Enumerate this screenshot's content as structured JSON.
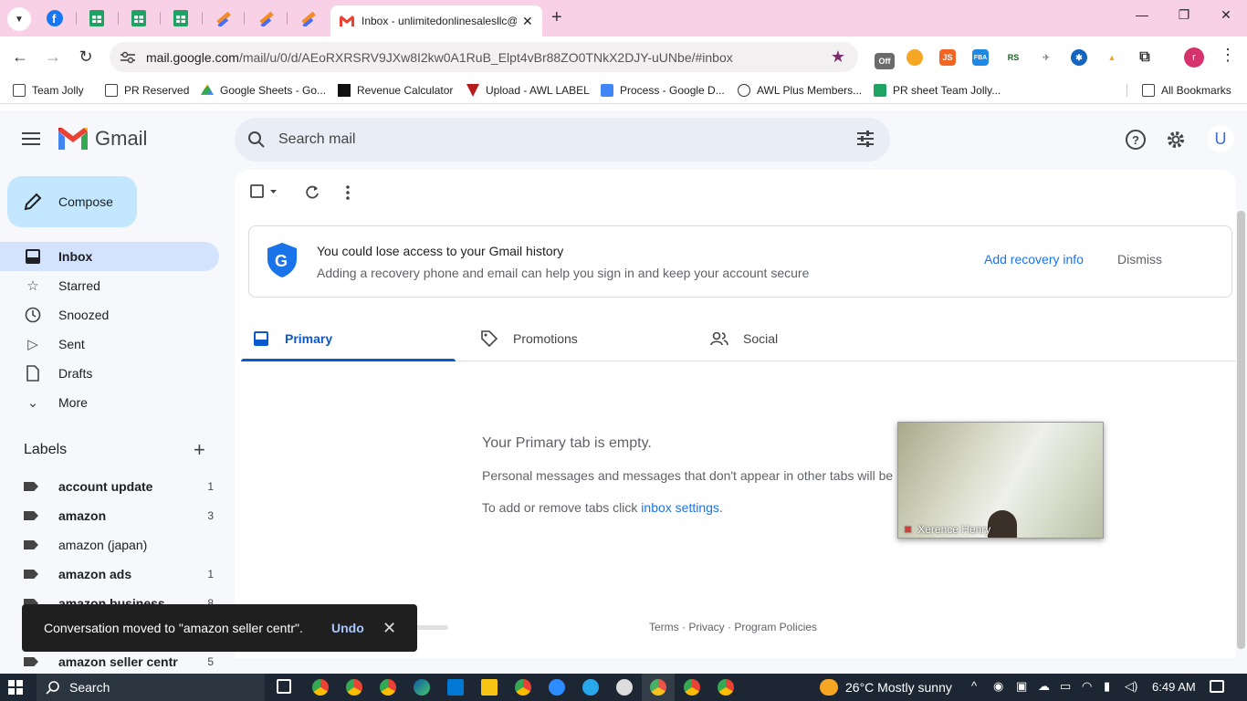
{
  "browser": {
    "active_tab_title": "Inbox - unlimitedonlinesalesllc@",
    "url_host": "mail.google.com",
    "url_path": "/mail/u/0/d/AEoRXRSRV9JXw8I2kw0A1RuB_Elpt4vBr88ZO0TNkX2DJY-uUNbe/#inbox",
    "profile_initial": "r",
    "bookmarks": [
      "Team Jolly",
      "PR Reserved",
      "Google Sheets - Go...",
      "Revenue Calculator",
      "Upload - AWL LABEL",
      "Process - Google D...",
      "AWL Plus Members...",
      "PR sheet Team Jolly..."
    ],
    "all_bookmarks": "All Bookmarks",
    "extension_labels": [
      "Off",
      "JS",
      "FBA",
      "RS"
    ]
  },
  "gmail": {
    "brand": "Gmail",
    "search_placeholder": "Search mail",
    "account_initial": "U",
    "compose": "Compose",
    "nav": [
      {
        "label": "Inbox",
        "icon": "inbox-icon"
      },
      {
        "label": "Starred",
        "icon": "star-icon"
      },
      {
        "label": "Snoozed",
        "icon": "clock-icon"
      },
      {
        "label": "Sent",
        "icon": "send-icon"
      },
      {
        "label": "Drafts",
        "icon": "draft-icon"
      },
      {
        "label": "More",
        "icon": "chevron-down-icon"
      }
    ],
    "labels_heading": "Labels",
    "labels": [
      {
        "name": "account update",
        "count": "1"
      },
      {
        "name": "amazon",
        "count": "3"
      },
      {
        "name": "amazon (japan)",
        "count": ""
      },
      {
        "name": "amazon ads",
        "count": "1"
      },
      {
        "name": "amazon business",
        "count": "8"
      },
      {
        "name": "amazon seller centr",
        "count": "5"
      }
    ],
    "banner": {
      "title": "You could lose access to your Gmail history",
      "subtitle": "Adding a recovery phone and email can help you sign in and keep your account secure",
      "action": "Add recovery info",
      "dismiss": "Dismiss"
    },
    "tabs": [
      "Primary",
      "Promotions",
      "Social"
    ],
    "empty_title": "Your Primary tab is empty.",
    "empty_line1": "Personal messages and messages that don't appear in other tabs will be",
    "empty_line2_prefix": "To add or remove tabs click ",
    "empty_line2_link": "inbox settings",
    "empty_line2_suffix": ".",
    "footer": "Terms · Privacy · Program Policies",
    "snackbar": {
      "message": "Conversation moved to \"amazon seller centr\".",
      "undo": "Undo"
    }
  },
  "video_overlay": {
    "name": "Xerence Henry"
  },
  "taskbar": {
    "search": "Search",
    "weather": "26°C  Mostly sunny",
    "time": "6:49 AM"
  }
}
